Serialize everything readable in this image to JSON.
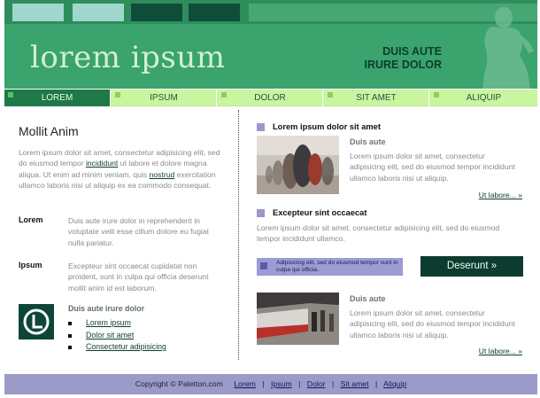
{
  "header": {
    "brand": "lorem ipsum",
    "tagline_line1": "DUIS AUTE",
    "tagline_line2": "IRURE DOLOR"
  },
  "nav": [
    {
      "label": "LOREM",
      "active": true
    },
    {
      "label": "IPSUM",
      "active": false
    },
    {
      "label": "DOLOR",
      "active": false
    },
    {
      "label": "SIT AMET",
      "active": false
    },
    {
      "label": "ALIQUIP",
      "active": false
    }
  ],
  "left": {
    "title": "Mollit Anim",
    "intro_part1": "Lorem ipsum dolor sit amet, consectetur adipisicing elit, sed do eiusmod tempor",
    "intro_link1": "incididunt",
    "intro_part2": "ut labore et dolore magna aliqua. Ut enim ad minim veniam, quis",
    "intro_link2": "nostrud",
    "intro_part3": "exercitation ullamco laboris nisi ut aliquip ex ea commodo consequat.",
    "items": [
      {
        "key": "Lorem",
        "text": "Duis aute irure dolor in reprehenderit in voluptate velit esse cillum dolore eu fugiat nulla pariatur."
      },
      {
        "key": "Ipsum",
        "text": "Excepteur sint occaecat cupidatat non proident, sunt in culpa qui officia deserunt mollit anim id est laborum."
      }
    ],
    "bottom_title": "Duis aute irure dolor",
    "links": [
      "Lorem ipsum",
      "Dolor sit amet",
      "Consectetur adipisicing"
    ]
  },
  "right": {
    "article1": {
      "heading": "Lorem ipsum dolor sit amet",
      "subheading": "Duis aute",
      "text": "Lorem ipsum dolor sit amet, consectetur adipisicing elit, sed do eiusmod tempor incididunt ullamco laboris nisi ut aliquip.",
      "more": "Ut labore... »"
    },
    "article2": {
      "heading": "Excepteur sint occaecat",
      "text": "Lorem ipsum dolor sit amet, consectetur adipisicing elit, sed do eiusmod tempor incididunt ullamco."
    },
    "promo_text": "Adipisicing elit, sed do eiusmod tempor sunt in culpa qui officia.",
    "cta_label": "Deserunt »",
    "article3": {
      "subheading": "Duis aute",
      "text": "Lorem ipsum dolor sit amet, consectetur adipisicing elit, sed do eiusmod tempor incididunt ullamco laboris nisi ut aliquip.",
      "more": "Ut labore... »"
    }
  },
  "footer": {
    "copyright": "Copyright © Paletton.com",
    "links": [
      "Lorem",
      "Ipsum",
      "Dolor",
      "Sit amet",
      "Aliquip"
    ]
  }
}
